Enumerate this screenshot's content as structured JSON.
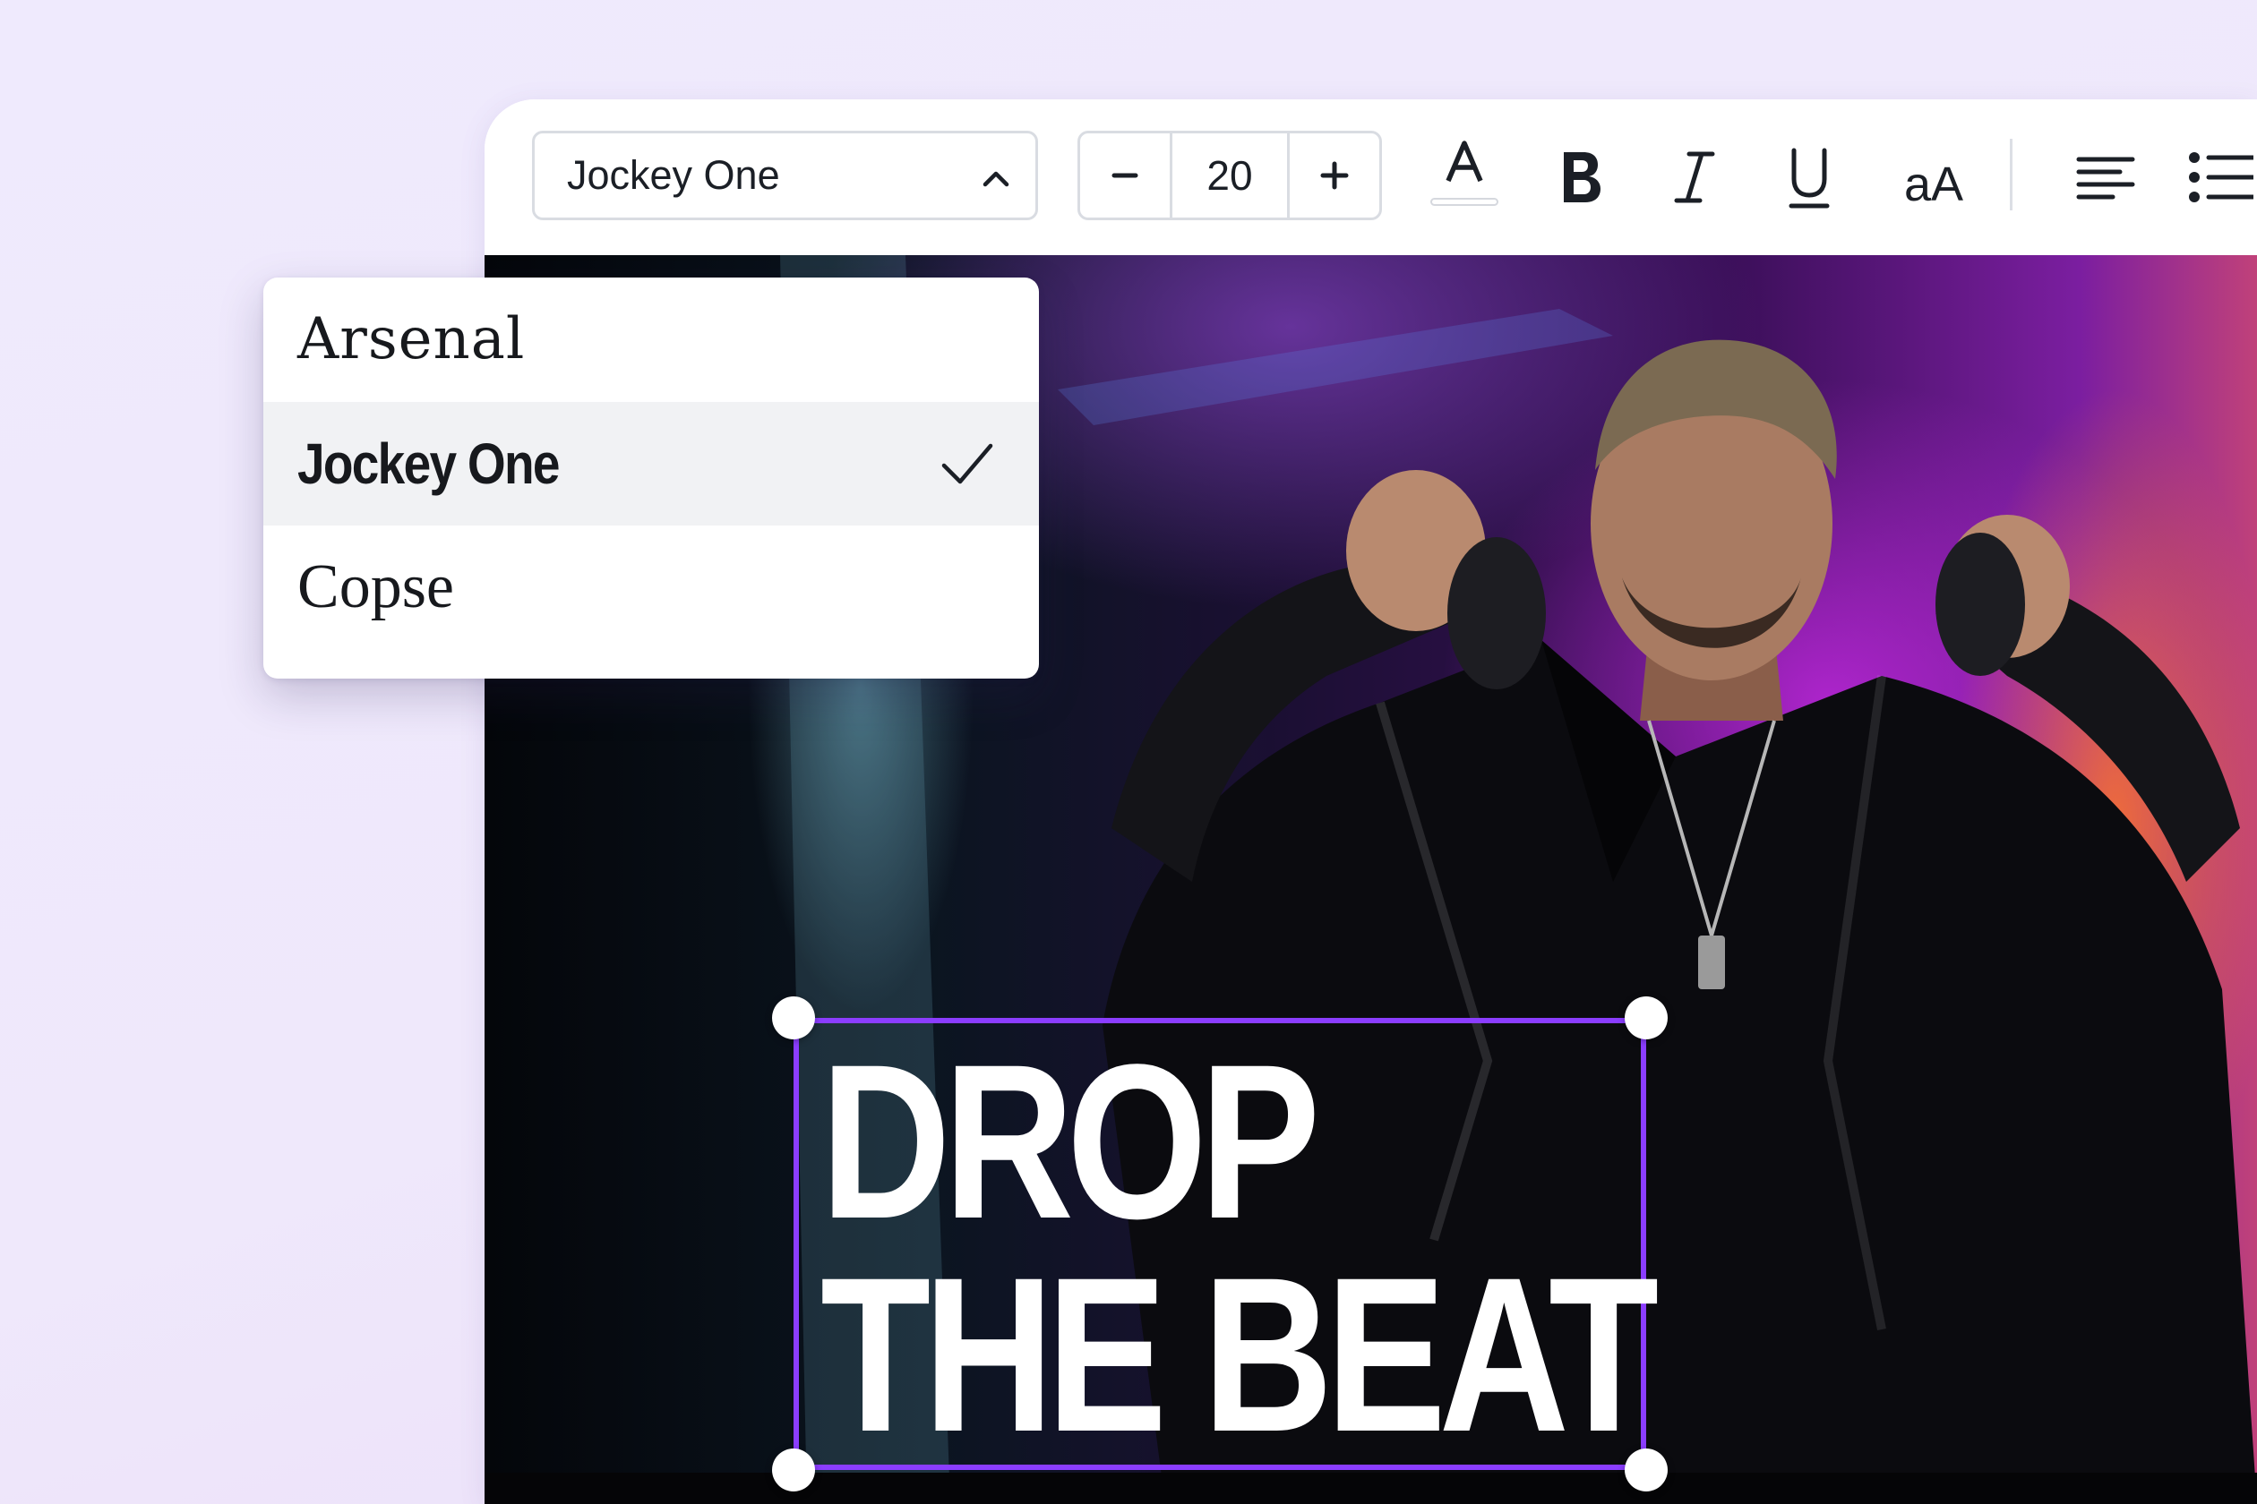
{
  "toolbar": {
    "font_family": "Jockey One",
    "font_size": "20",
    "decrease_symbol": "−",
    "increase_symbol": "+",
    "icons": [
      "text-color-icon",
      "bold-icon",
      "italic-icon",
      "underline-icon",
      "letter-case-icon",
      "align-left-icon",
      "bullet-list-icon"
    ]
  },
  "font_dropdown": {
    "items": [
      {
        "label": "Arsenal",
        "selected": false
      },
      {
        "label": "Jockey One",
        "selected": true
      },
      {
        "label": "Copse",
        "selected": false
      }
    ]
  },
  "canvas": {
    "headline_line1": "DROP",
    "headline_line2": "THE BEAT"
  },
  "colors": {
    "selection_accent": "#8b3dff",
    "background": "#efeafd"
  }
}
